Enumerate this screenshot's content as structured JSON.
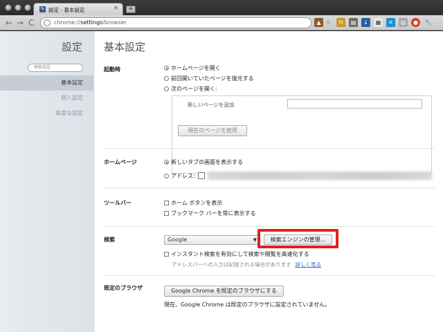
{
  "window": {
    "tab_title": "設定 - 基本設定",
    "tab_close": "×",
    "new_tab": "+",
    "url_prefix": "chrome://",
    "url_host": "settings",
    "url_path": "/browser"
  },
  "toolbar": {
    "back": "←",
    "forward": "→",
    "reload": "C"
  },
  "sidebar": {
    "title": "設定",
    "search_placeholder": "検索設定",
    "items": [
      {
        "label": "基本設定",
        "active": true
      },
      {
        "label": "個人設定",
        "active": false
      },
      {
        "label": "高度な設定",
        "active": false
      }
    ]
  },
  "main": {
    "title": "基本設定",
    "startup": {
      "label": "起動時",
      "options": [
        "ホームページを開く",
        "前回開いていたページを復元する",
        "次のページを開く:"
      ],
      "selected": 0,
      "add_page_label": "新しいページを追加",
      "use_current_button": "現在のページを使用"
    },
    "homepage": {
      "label": "ホームページ",
      "options": [
        "新しいタブの画面を表示する",
        "アドレス:"
      ],
      "selected": 0
    },
    "toolbar_section": {
      "label": "ツールバー",
      "options": [
        "ホーム ボタンを表示",
        "ブックマーク バーを常に表示する"
      ]
    },
    "search": {
      "label": "検索",
      "engine": "Google",
      "manage_button": "検索エンジンの管理...",
      "instant_checkbox": "インスタント検索を有効にして検索や閲覧を高速化する",
      "hint": "アドレスバーへの入力は記録される場合があります",
      "learn_more": "詳しく見る"
    },
    "default_browser": {
      "label": "既定のブラウザ",
      "button": "Google Chrome を既定のブラウザにする",
      "status": "現在、Google Chrome は既定のブラウザに設定されていません。"
    }
  },
  "colors": {
    "highlight": "#e02020",
    "link": "#3366cc",
    "sidebar_active": "#c6cdd7"
  }
}
